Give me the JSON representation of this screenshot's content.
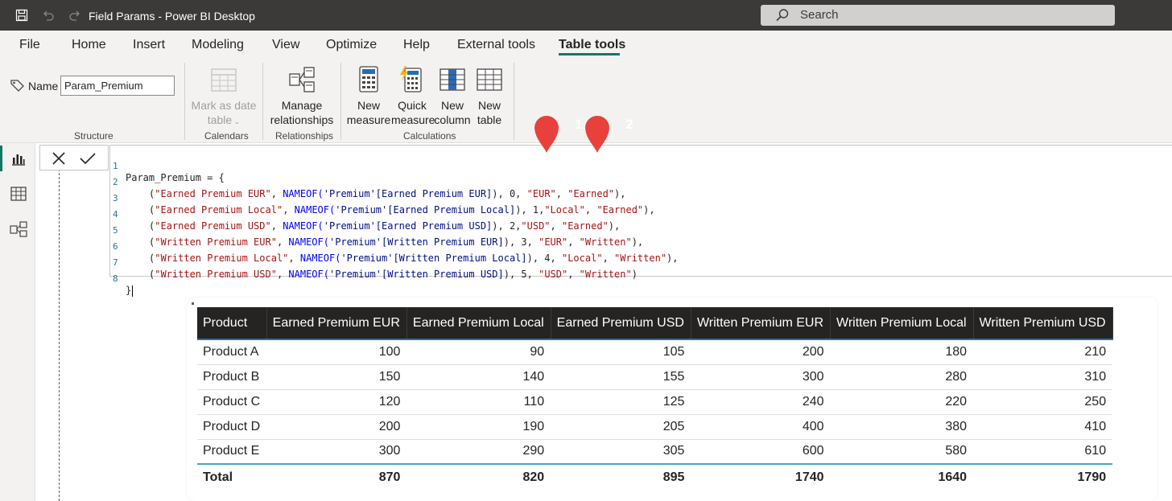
{
  "titlebar": {
    "title": "Field Params - Power BI Desktop",
    "search_placeholder": "Search",
    "icons": [
      "save-icon",
      "undo-icon",
      "redo-icon",
      "search-icon"
    ]
  },
  "tabs": [
    "File",
    "Home",
    "Insert",
    "Modeling",
    "View",
    "Optimize",
    "Help",
    "External tools",
    "Table tools"
  ],
  "active_tab": "Table tools",
  "ribbon": {
    "structure": {
      "name_label": "Name",
      "name_value": "Param_Premium",
      "group_label": "Structure"
    },
    "calendars": {
      "mark_as_date_line1": "Mark as date",
      "mark_as_date_line2": "table",
      "group_label": "Calendars"
    },
    "relationships": {
      "manage_line1": "Manage",
      "manage_line2": "relationships",
      "group_label": "Relationships"
    },
    "calculations": {
      "new_measure_line1": "New",
      "new_measure_line2": "measure",
      "quick_measure_line1": "Quick",
      "quick_measure_line2": "measure",
      "new_column_line1": "New",
      "new_column_line2": "column",
      "new_table_line1": "New",
      "new_table_line2": "table",
      "group_label": "Calculations"
    }
  },
  "formula": {
    "line_numbers": [
      "1",
      "2",
      "3",
      "4",
      "5",
      "6",
      "7",
      "8"
    ],
    "header": "Param_Premium = {",
    "rows": [
      {
        "name": "\"Earned Premium EUR\"",
        "fn": "NAMEOF(",
        "ref": "'Premium'[Earned Premium EUR]",
        "rest": "), 0, ",
        "cur": "\"EUR\"",
        "sep": ", ",
        "type": "\"Earned\"",
        "end": "),"
      },
      {
        "name": "\"Earned Premium Local\"",
        "fn": "NAMEOF(",
        "ref": "'Premium'[Earned Premium Local]",
        "rest": "), 1,",
        "cur": "\"Local\"",
        "sep": ", ",
        "type": "\"Earned\"",
        "end": "),"
      },
      {
        "name": "\"Earned Premium USD\"",
        "fn": "NAMEOF(",
        "ref": "'Premium'[Earned Premium USD]",
        "rest": "), 2,",
        "cur": "\"USD\"",
        "sep": ", ",
        "type": "\"Earned\"",
        "end": "),"
      },
      {
        "name": "\"Written Premium EUR\"",
        "fn": "NAMEOF(",
        "ref": "'Premium'[Written Premium EUR]",
        "rest": "), 3, ",
        "cur": "\"EUR\"",
        "sep": ", ",
        "type": "\"Written\"",
        "end": "),"
      },
      {
        "name": "\"Written Premium Local\"",
        "fn": "NAMEOF(",
        "ref": "'Premium'[Written Premium Local]",
        "rest": "), 4, ",
        "cur": "\"Local\"",
        "sep": ", ",
        "type": "\"Written\"",
        "end": "),"
      },
      {
        "name": "\"Written Premium USD\"",
        "fn": "NAMEOF(",
        "ref": "'Premium'[Written Premium USD]",
        "rest": "), 5, ",
        "cur": "\"USD\"",
        "sep": ", ",
        "type": "\"Written\"",
        "end": ")"
      }
    ],
    "footer": "}"
  },
  "markers": [
    "1",
    "2"
  ],
  "table": {
    "headers": [
      "Product",
      "Earned Premium EUR",
      "Earned Premium Local",
      "Earned Premium USD",
      "Written Premium EUR",
      "Written Premium Local",
      "Written Premium USD"
    ],
    "rows": [
      [
        "Product A",
        "100",
        "90",
        "105",
        "200",
        "180",
        "210"
      ],
      [
        "Product B",
        "150",
        "140",
        "155",
        "300",
        "280",
        "310"
      ],
      [
        "Product C",
        "120",
        "110",
        "125",
        "240",
        "220",
        "250"
      ],
      [
        "Product D",
        "200",
        "190",
        "205",
        "400",
        "380",
        "410"
      ],
      [
        "Product E",
        "300",
        "290",
        "305",
        "600",
        "580",
        "610"
      ]
    ],
    "total": [
      "Total",
      "870",
      "820",
      "895",
      "1740",
      "1640",
      "1790"
    ]
  },
  "colors": {
    "titlebar": "#3b3a39",
    "ribbon": "#f3f2f1",
    "accent": "#117865",
    "marker": "#e8413c",
    "table_header": "#252423"
  }
}
